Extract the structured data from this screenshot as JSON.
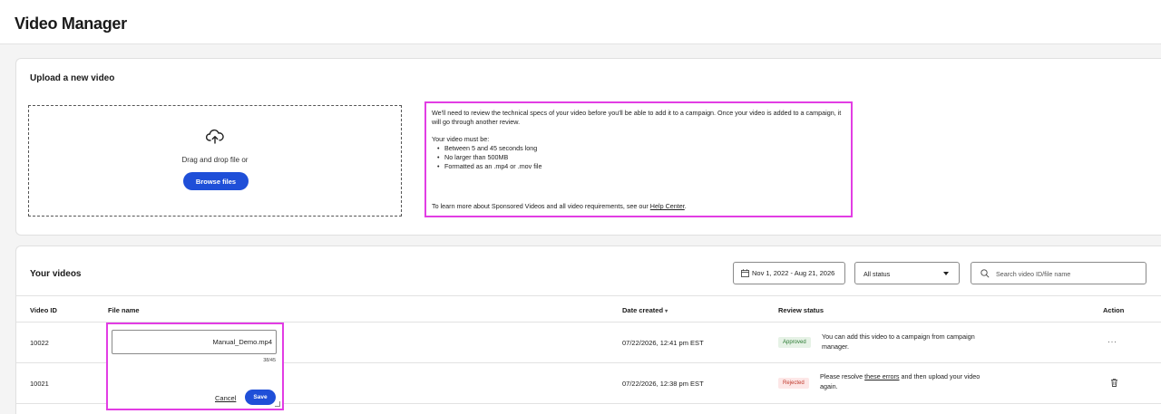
{
  "header": {
    "title": "Video Manager"
  },
  "upload": {
    "title": "Upload a new video",
    "drag_text": "Drag and drop file or",
    "browse_label": "Browse files",
    "info_para": "We'll need to review the technical specs of your video before you'll be able to add it to a campaign. Once your video is added to a campaign, it will go through another review.",
    "must_be": "Your video must be:",
    "requirements": [
      "Between 5 and 45 seconds long",
      "No larger than 500MB",
      "Formatted as an .mp4 or .mov file"
    ],
    "learn_more_prefix": "To learn more about Sponsored Videos and all video requirements, see our ",
    "help_link": "Help Center",
    "learn_more_suffix": "."
  },
  "videos": {
    "title": "Your videos",
    "date_range": "Nov 1, 2022 - Aug 21, 2026",
    "status_filter": "All status",
    "search_placeholder": "Search video ID/file name",
    "columns": {
      "id": "Video ID",
      "file": "File name",
      "date": "Date created",
      "date_sort": "▾",
      "review": "Review status",
      "action": "Action"
    },
    "rows": [
      {
        "id": "10022",
        "date": "07/22/2026, 12:41 pm EST",
        "badge": "Approved",
        "review": "You can add this video to a campaign from campaign manager.",
        "action": "···"
      },
      {
        "id": "10021",
        "date": "07/22/2026, 12:38 pm EST",
        "badge": "Rejected",
        "review_prefix": "Please resolve ",
        "review_link": "these errors",
        "review_suffix": " and then upload your video again."
      }
    ],
    "edit": {
      "value": "Manual_Demo.mp4",
      "count": "38/45",
      "cancel": "Cancel",
      "save": "Save"
    }
  },
  "colors": {
    "accent": "#1f4fd8",
    "highlight": "#e23de4",
    "approved": "#2a7a32",
    "rejected": "#c0392b"
  }
}
